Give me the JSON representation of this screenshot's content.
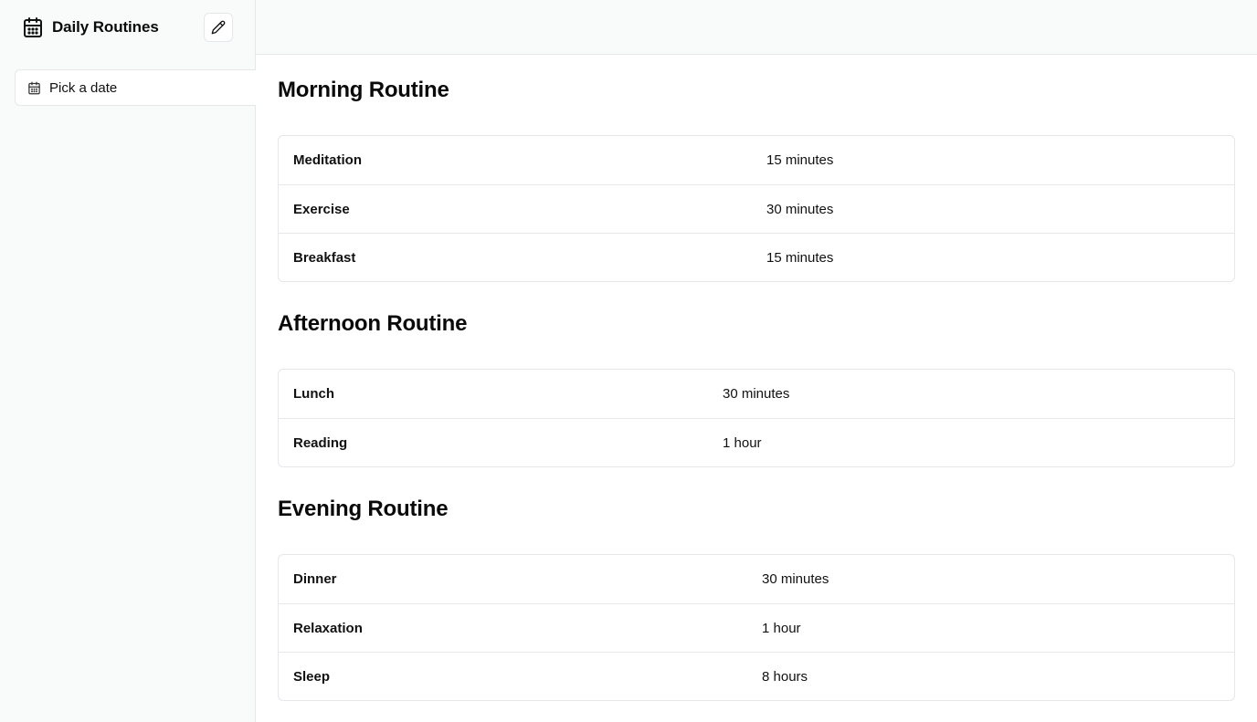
{
  "app": {
    "title": "Daily Routines"
  },
  "date_picker": {
    "label": "Pick a date"
  },
  "icons": {
    "calendar": "calendar-icon",
    "edit": "pencil-icon"
  },
  "routines": [
    {
      "title": "Morning Routine",
      "items": [
        {
          "activity": "Meditation",
          "duration": "15 minutes"
        },
        {
          "activity": "Exercise",
          "duration": "30 minutes"
        },
        {
          "activity": "Breakfast",
          "duration": "15 minutes"
        }
      ]
    },
    {
      "title": "Afternoon Routine",
      "items": [
        {
          "activity": "Lunch",
          "duration": "30 minutes"
        },
        {
          "activity": "Reading",
          "duration": "1 hour"
        }
      ]
    },
    {
      "title": "Evening Routine",
      "items": [
        {
          "activity": "Dinner",
          "duration": "30 minutes"
        },
        {
          "activity": "Relaxation",
          "duration": "1 hour"
        },
        {
          "activity": "Sleep",
          "duration": "8 hours"
        }
      ]
    }
  ]
}
